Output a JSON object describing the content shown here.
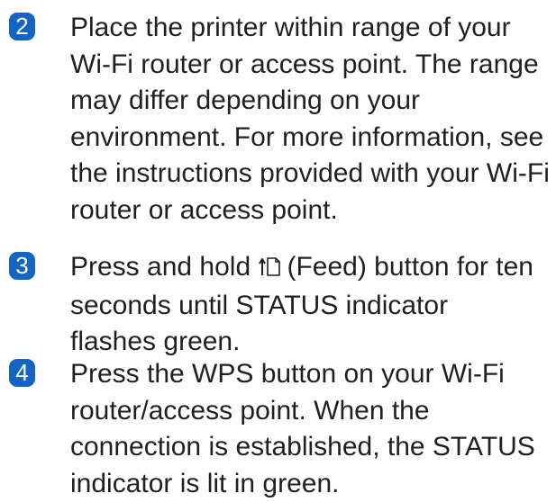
{
  "steps": [
    {
      "number": "2",
      "lines": [
        "Place the printer within range of your",
        "Wi-Fi router or access point. The range",
        "may differ depending on your",
        "environment. For more information, see",
        "the instructions provided with your Wi-Fi",
        "router or access point."
      ]
    },
    {
      "number": "3",
      "line1_before_icon": "Press and hold ",
      "line1_after_icon": "(Feed) button for ten",
      "lines": [
        "seconds until STATUS indicator",
        "flashes green."
      ]
    },
    {
      "number": "4",
      "lines": [
        "Press the WPS button on your Wi-Fi",
        "router/access point. When the",
        "connection is established, the STATUS",
        "indicator is lit in green."
      ]
    }
  ],
  "colors": {
    "badge": "#1565c0",
    "text": "#231f20"
  },
  "icons": {
    "feed": "feed-button-icon"
  }
}
